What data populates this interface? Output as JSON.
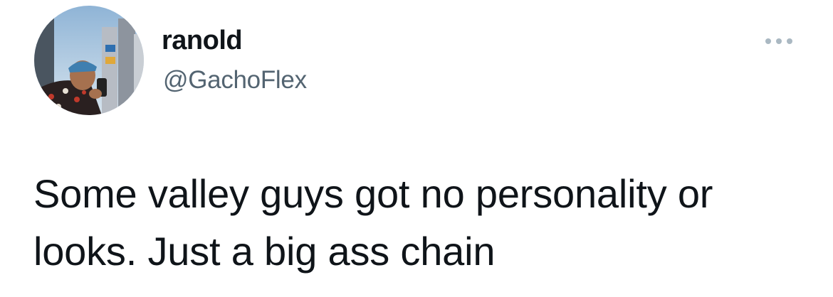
{
  "user": {
    "display_name": "ranold",
    "handle": "@GachoFlex",
    "avatar_icon": "profile-photo"
  },
  "menu": {
    "icon": "more-horizontal-icon"
  },
  "tweet": {
    "text": "Some valley guys got no personality or looks. Just a big ass chain"
  },
  "colors": {
    "text_primary": "#0f1419",
    "text_secondary": "#536471",
    "menu_dots": "#aab8c2",
    "background": "#ffffff"
  }
}
